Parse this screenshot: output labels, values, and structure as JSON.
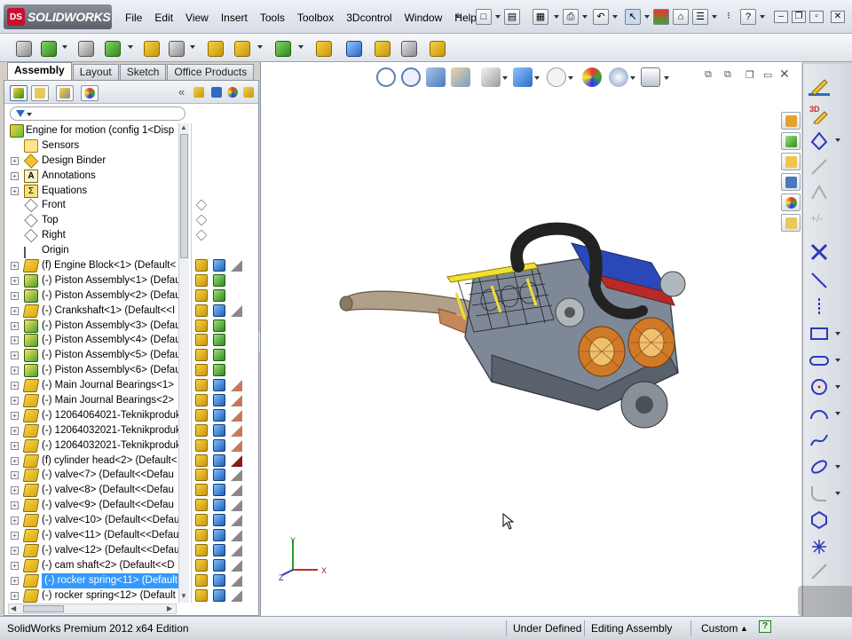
{
  "app": {
    "logo_badge": "DS",
    "logo_text": "SOLIDWORKS",
    "menu": [
      "File",
      "Edit",
      "View",
      "Insert",
      "Tools",
      "Toolbox",
      "3Dcontrol",
      "Window",
      "Help"
    ]
  },
  "command_tabs": [
    "Assembly",
    "Layout",
    "Sketch",
    "Office Products"
  ],
  "active_tab": "Assembly",
  "tree": {
    "root": "Engine for motion  (config 1<Disp",
    "items": [
      {
        "label": "Sensors",
        "icon": "sensor-icon",
        "expand": false
      },
      {
        "label": "Design Binder",
        "icon": "binder-icon",
        "expand": true
      },
      {
        "label": "Annotations",
        "icon": "annotations-icon",
        "expand": true
      },
      {
        "label": "Equations",
        "icon": "equations-icon",
        "expand": true
      },
      {
        "label": "Front",
        "icon": "plane-icon",
        "expand": false
      },
      {
        "label": "Top",
        "icon": "plane-icon",
        "expand": false
      },
      {
        "label": "Right",
        "icon": "plane-icon",
        "expand": false
      },
      {
        "label": "Origin",
        "icon": "origin-icon",
        "expand": false
      },
      {
        "label": "(f) Engine Block<1> (Default<",
        "icon": "part-icon",
        "expand": true
      },
      {
        "label": "(-) Piston Assembly<1> (Defau",
        "icon": "subassembly-icon",
        "expand": true
      },
      {
        "label": "(-) Piston Assembly<2> (Defau",
        "icon": "subassembly-icon",
        "expand": true
      },
      {
        "label": "(-) Crankshaft<1> (Default<<I",
        "icon": "part-icon",
        "expand": true
      },
      {
        "label": "(-) Piston Assembly<3> (Defau",
        "icon": "subassembly-icon",
        "expand": true
      },
      {
        "label": "(-) Piston Assembly<4> (Defau",
        "icon": "subassembly-icon",
        "expand": true
      },
      {
        "label": "(-) Piston Assembly<5> (Defau",
        "icon": "subassembly-icon",
        "expand": true
      },
      {
        "label": "(-) Piston Assembly<6> (Defau",
        "icon": "subassembly-icon",
        "expand": true
      },
      {
        "label": "(-) Main Journal Bearings<1>",
        "icon": "part-icon",
        "expand": true
      },
      {
        "label": "(-) Main Journal Bearings<2>",
        "icon": "part-icon",
        "expand": true
      },
      {
        "label": "(-) 12064064021-Teknikproduk",
        "icon": "part-icon",
        "expand": true
      },
      {
        "label": "(-) 12064032021-Teknikproduk",
        "icon": "part-icon",
        "expand": true
      },
      {
        "label": "(-) 12064032021-Teknikproduk",
        "icon": "part-icon",
        "expand": true
      },
      {
        "label": "(f) cylinder head<2> (Default<",
        "icon": "part-icon",
        "expand": true
      },
      {
        "label": "(-) valve<7> (Default<<Defau",
        "icon": "part-icon",
        "expand": true
      },
      {
        "label": "(-) valve<8> (Default<<Defau",
        "icon": "part-icon",
        "expand": true
      },
      {
        "label": "(-) valve<9> (Default<<Defau",
        "icon": "part-icon",
        "expand": true
      },
      {
        "label": "(-) valve<10> (Default<<Defau",
        "icon": "part-icon",
        "expand": true
      },
      {
        "label": "(-) valve<11> (Default<<Defau",
        "icon": "part-icon",
        "expand": true
      },
      {
        "label": "(-) valve<12> (Default<<Defau",
        "icon": "part-icon",
        "expand": true
      },
      {
        "label": "(-) cam shaft<2> (Default<<D",
        "icon": "part-icon",
        "expand": true
      },
      {
        "label": "(-) rocker spring<11> (Default",
        "icon": "part-icon",
        "expand": true,
        "selected": true
      },
      {
        "label": "(-) rocker spring<12> (Default",
        "icon": "part-icon",
        "expand": true
      }
    ]
  },
  "statusbar": {
    "edition": "SolidWorks Premium 2012 x64 Edition",
    "state": "Under Defined",
    "mode": "Editing Assembly",
    "units": "Custom",
    "help_icon": "?"
  },
  "triad": {
    "x": "X",
    "y": "Y",
    "z": "Z"
  },
  "colors": {
    "selection": "#3399ff",
    "brand_red": "#c8102e",
    "accent_blue": "#2a6cc4"
  }
}
